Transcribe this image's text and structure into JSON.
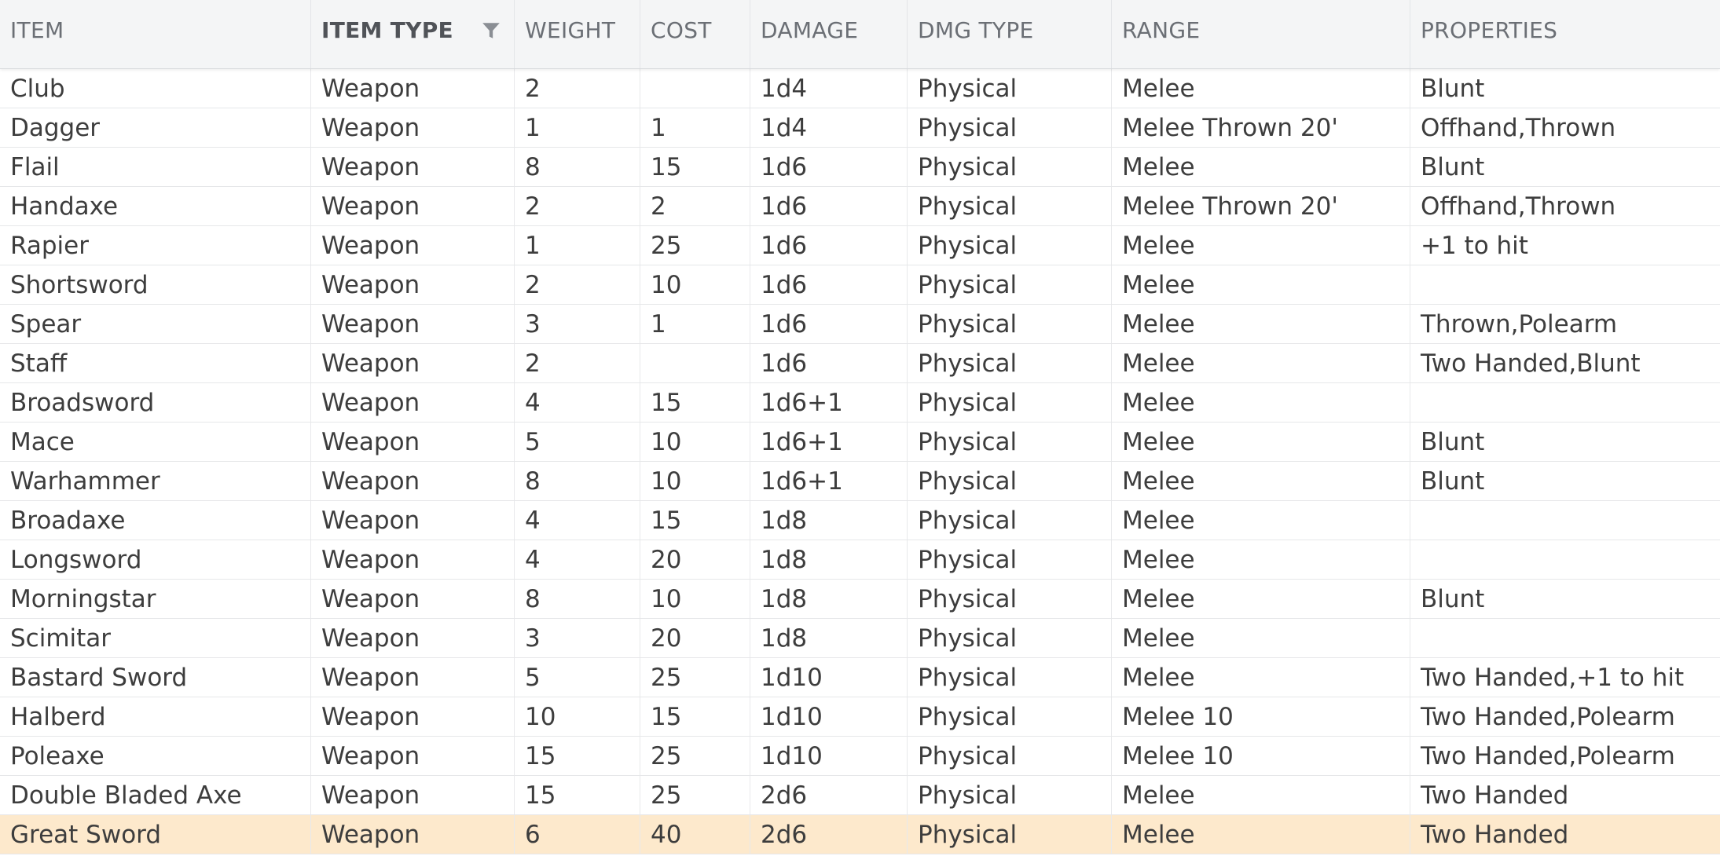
{
  "grid": {
    "columns": [
      {
        "label": "ITEM"
      },
      {
        "label": "ITEM TYPE",
        "filter_icon": "filter-icon"
      },
      {
        "label": "WEIGHT"
      },
      {
        "label": "COST"
      },
      {
        "label": "DAMAGE"
      },
      {
        "label": "DMG TYPE"
      },
      {
        "label": "RANGE"
      },
      {
        "label": "PROPERTIES"
      }
    ],
    "selected_row_color": "#fde9cc",
    "rows": [
      {
        "cells": [
          "Club",
          "Weapon",
          "2",
          "",
          "1d4",
          "Physical",
          "Melee",
          "Blunt"
        ]
      },
      {
        "cells": [
          "Dagger",
          "Weapon",
          "1",
          "1",
          "1d4",
          "Physical",
          "Melee Thrown 20'",
          "Offhand,Thrown"
        ]
      },
      {
        "cells": [
          "Flail",
          "Weapon",
          "8",
          "15",
          "1d6",
          "Physical",
          "Melee",
          "Blunt"
        ]
      },
      {
        "cells": [
          "Handaxe",
          "Weapon",
          "2",
          "2",
          "1d6",
          "Physical",
          "Melee Thrown 20'",
          "Offhand,Thrown"
        ]
      },
      {
        "cells": [
          "Rapier",
          "Weapon",
          "1",
          "25",
          "1d6",
          "Physical",
          "Melee",
          "+1 to hit"
        ]
      },
      {
        "cells": [
          "Shortsword",
          "Weapon",
          "2",
          "10",
          "1d6",
          "Physical",
          "Melee",
          ""
        ]
      },
      {
        "cells": [
          "Spear",
          "Weapon",
          "3",
          "1",
          "1d6",
          "Physical",
          "Melee",
          "Thrown,Polearm"
        ]
      },
      {
        "cells": [
          "Staff",
          "Weapon",
          "2",
          "",
          "1d6",
          "Physical",
          "Melee",
          "Two Handed,Blunt"
        ]
      },
      {
        "cells": [
          "Broadsword",
          "Weapon",
          "4",
          "15",
          "1d6+1",
          "Physical",
          "Melee",
          ""
        ]
      },
      {
        "cells": [
          "Mace",
          "Weapon",
          "5",
          "10",
          "1d6+1",
          "Physical",
          "Melee",
          "Blunt"
        ]
      },
      {
        "cells": [
          "Warhammer",
          "Weapon",
          "8",
          "10",
          "1d6+1",
          "Physical",
          "Melee",
          "Blunt"
        ]
      },
      {
        "cells": [
          "Broadaxe",
          "Weapon",
          "4",
          "15",
          "1d8",
          "Physical",
          "Melee",
          ""
        ]
      },
      {
        "cells": [
          "Longsword",
          "Weapon",
          "4",
          "20",
          "1d8",
          "Physical",
          "Melee",
          ""
        ]
      },
      {
        "cells": [
          "Morningstar",
          "Weapon",
          "8",
          "10",
          "1d8",
          "Physical",
          "Melee",
          "Blunt"
        ]
      },
      {
        "cells": [
          "Scimitar",
          "Weapon",
          "3",
          "20",
          "1d8",
          "Physical",
          "Melee",
          ""
        ]
      },
      {
        "cells": [
          "Bastard Sword",
          "Weapon",
          "5",
          "25",
          "1d10",
          "Physical",
          "Melee",
          "Two Handed,+1 to hit"
        ]
      },
      {
        "cells": [
          "Halberd",
          "Weapon",
          "10",
          "15",
          "1d10",
          "Physical",
          "Melee 10",
          "Two Handed,Polearm"
        ]
      },
      {
        "cells": [
          "Poleaxe",
          "Weapon",
          "15",
          "25",
          "1d10",
          "Physical",
          "Melee 10",
          "Two Handed,Polearm"
        ]
      },
      {
        "cells": [
          "Double Bladed Axe",
          "Weapon",
          "15",
          "25",
          "2d6",
          "Physical",
          "Melee",
          "Two Handed"
        ]
      },
      {
        "cells": [
          "Great Sword",
          "Weapon",
          "6",
          "40",
          "2d6",
          "Physical",
          "Melee",
          "Two Handed"
        ],
        "selected": true
      }
    ]
  }
}
